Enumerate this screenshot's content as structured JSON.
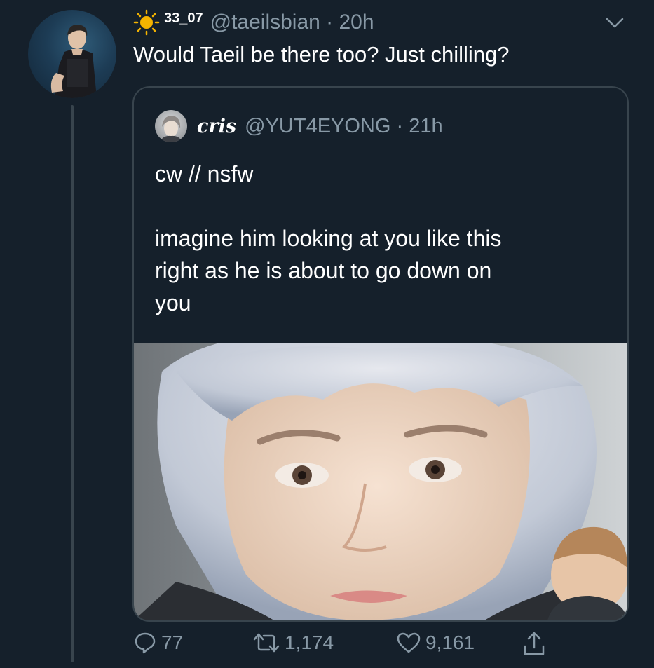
{
  "tweet": {
    "display_name": "33_07",
    "handle_time": "@taeilsbian · 20h",
    "text": "Would Taeil be there too? Just chilling?",
    "icons": {
      "name_prefix": "sun-icon",
      "menu": "chevron-down-icon"
    }
  },
  "quote": {
    "display_name": "cris",
    "handle_time": "@YUT4EYONG · 21h",
    "text_lines": [
      "cw // nsfw",
      "",
      "imagine him looking at you like this",
      "right as he is about to go down on",
      "you"
    ]
  },
  "actions": {
    "reply_count": "77",
    "retweet_count": "1,174",
    "like_count": "9,161",
    "icons": [
      "reply-icon",
      "retweet-icon",
      "like-icon",
      "share-icon"
    ]
  },
  "colors": {
    "background": "#15202b",
    "text": "#ffffff",
    "secondary_text": "#8899a6",
    "border": "#38444d",
    "sun": "#f5b400"
  }
}
